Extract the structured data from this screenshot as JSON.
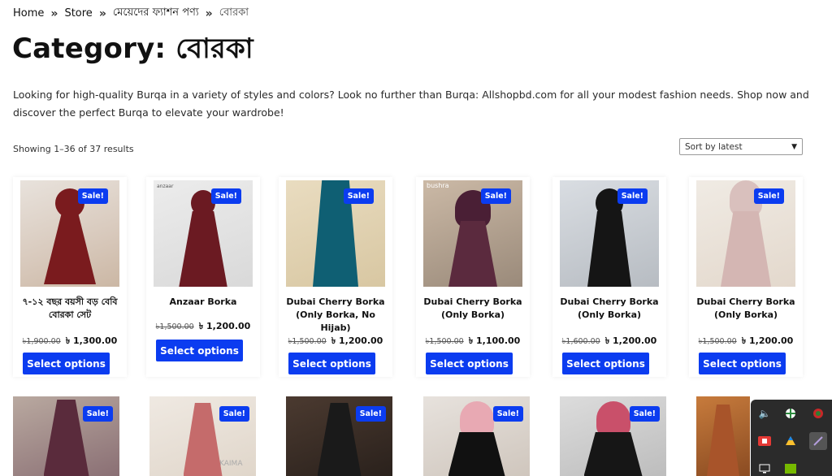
{
  "breadcrumb": {
    "home": "Home",
    "store": "Store",
    "parent": "মেয়েদের ফ্যাশন পণ্য",
    "current": "বোরকা",
    "separator": "»"
  },
  "page_title": "Category: বোরকা",
  "description": "Looking for high-quality Burqa in a variety of styles and colors? Look no further than Burqa: Allshopbd.com for all your modest fashion needs. Shop now and discover the perfect Burqa to elevate your wardrobe!",
  "result_count": "Showing 1–36 of 37 results",
  "sort": {
    "selected": "Sort by latest"
  },
  "sale_badge": "Sale!",
  "button_label": "Select options",
  "products": [
    {
      "name": "৭-১২ বছর বয়সী বড় বেবি বোরকা সেট",
      "old_price": "৳1,900.00",
      "new_price": "৳ 1,300.00"
    },
    {
      "name": "Anzaar Borka",
      "old_price": "৳1,500.00",
      "new_price": "৳ 1,200.00"
    },
    {
      "name": "Dubai Cherry Borka (Only Borka, No Hijab)",
      "old_price": "৳1,500.00",
      "new_price": "৳ 1,200.00"
    },
    {
      "name": "Dubai Cherry Borka (Only Borka)",
      "old_price": "৳1,500.00",
      "new_price": "৳ 1,100.00"
    },
    {
      "name": "Dubai Cherry Borka (Only Borka)",
      "old_price": "৳1,600.00",
      "new_price": "৳ 1,200.00"
    },
    {
      "name": "Dubai Cherry Borka (Only Borka)",
      "old_price": "৳1,500.00",
      "new_price": "৳ 1,200.00"
    }
  ],
  "image_text": {
    "brand_watermark_1": "anzaar",
    "brand_watermark_2": "bushra",
    "brand_watermark_3": "KAIMA"
  },
  "colors": {
    "accent": "#0b3cf0",
    "text": "#111111",
    "background": "#ffffff"
  }
}
